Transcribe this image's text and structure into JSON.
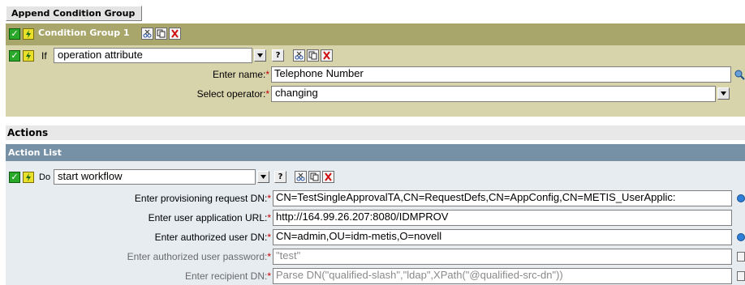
{
  "append_button": "Append Condition Group",
  "condition_group": {
    "title": "Condition Group 1",
    "if_label": "If",
    "if_select": "operation attribute",
    "enter_name_label": "Enter name:",
    "enter_name_value": "Telephone Number",
    "select_operator_label": "Select operator:",
    "select_operator_value": "changing",
    "help": "?"
  },
  "actions": {
    "section_title": "Actions",
    "list_title": "Action List",
    "do_label": "Do",
    "do_select": "start workflow",
    "help": "?",
    "fields": [
      {
        "label": "Enter provisioning request DN:",
        "value": "CN=TestSingleApprovalTA,CN=RequestDefs,CN=AppConfig,CN=METIS_UserApplic:",
        "disabled": false
      },
      {
        "label": "Enter user application URL:",
        "value": "http://164.99.26.207:8080/IDMPROV",
        "disabled": false
      },
      {
        "label": "Enter authorized user DN:",
        "value": "CN=admin,OU=idm-metis,O=novell",
        "disabled": false
      },
      {
        "label": "Enter authorized user password:",
        "value": "\"test\"",
        "disabled": true
      },
      {
        "label": "Enter recipient DN:",
        "value": "Parse DN(\"qualified-slash\",\"ldap\",XPath(\"@qualified-src-dn\"))",
        "disabled": true
      }
    ],
    "required_mark": "*"
  },
  "colors": {
    "condition_header": "#a9a66c",
    "condition_body": "#d7d4ac",
    "action_header": "#7690a6",
    "action_body": "#e7ecf1"
  }
}
